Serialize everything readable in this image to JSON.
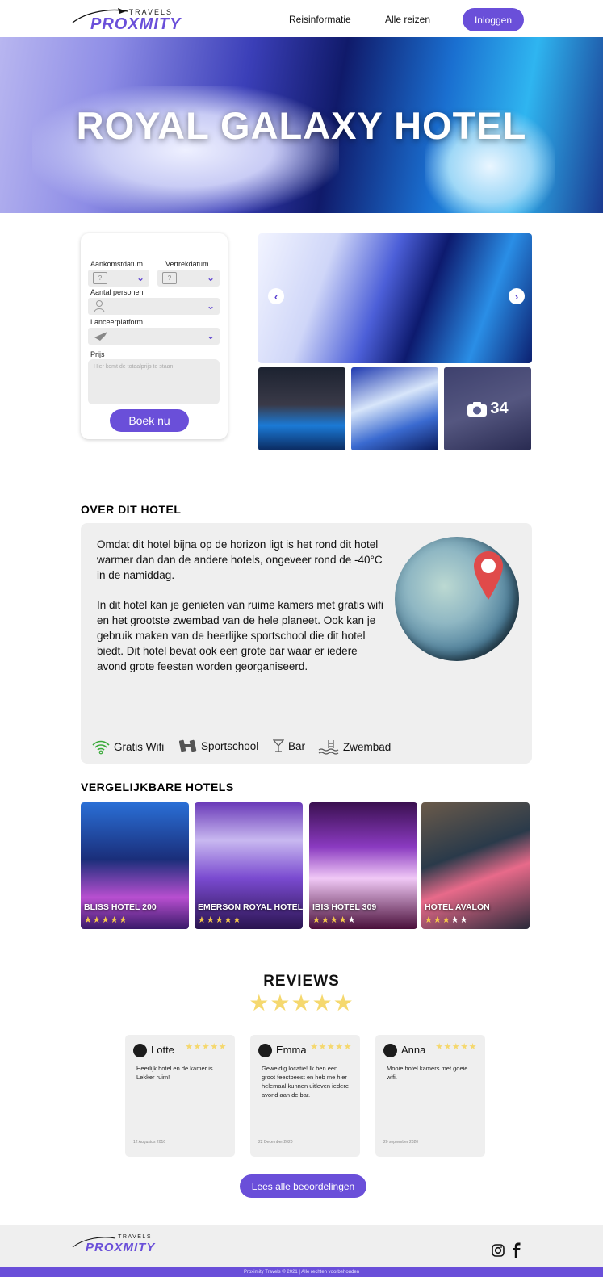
{
  "header": {
    "logo_travels": "TRAVELS",
    "logo_proximity": "PROXMITY",
    "nav": [
      "Reisinformatie",
      "Alle reizen"
    ],
    "login_label": "Inloggen"
  },
  "hero": {
    "title": "ROYAL GALAXY HOTEL"
  },
  "booking": {
    "arrival_label": "Aankomstdatum",
    "departure_label": "Vertrekdatum",
    "persons_label": "Aantal personen",
    "platform_label": "Lanceerplatform",
    "price_label": "Prijs",
    "price_placeholder": "Hier komt de totaalprijs te staan",
    "calendar_glyph": "?",
    "book_label": "Boek nu"
  },
  "gallery": {
    "photo_count": "34"
  },
  "about": {
    "title": "OVER DIT HOTEL",
    "paragraph_1": "Omdat dit hotel bijna op de horizon ligt is het rond dit hotel warmer dan dan de andere hotels, ongeveer rond de -40°C in de namiddag.",
    "paragraph_2": "In dit hotel kan je genieten van ruime kamers met gratis wifi en het grootste zwembad van de hele planeet. Ook kan je gebruik maken van de heerlijke sportschool die dit hotel biedt. Dit hotel bevat ook een grote bar waar er iedere avond grote feesten worden georganiseerd.",
    "amenities": [
      "Gratis Wifi",
      "Sportschool",
      "Bar",
      "Zwembad"
    ]
  },
  "similar": {
    "title": "VERGELIJKBARE HOTELS",
    "hotels": [
      {
        "name": "BLISS HOTEL 200",
        "rating": 5
      },
      {
        "name": "EMERSON ROYAL HOTEL",
        "rating": 5
      },
      {
        "name": "IBIS HOTEL 309",
        "rating": 4
      },
      {
        "name": "HOTEL AVALON",
        "rating": 3
      }
    ]
  },
  "reviews": {
    "title": "REVIEWS",
    "overall_rating": 5,
    "items": [
      {
        "name": "Lotte",
        "rating": 5,
        "text": "Heerlijk hotel en de kamer is Lekker ruim!",
        "date": "12 Augustus 2016"
      },
      {
        "name": "Emma",
        "rating": 5,
        "text": "Geweldig locatie! Ik ben een groot feestbeest en heb me hier helemaal kunnen uitleven iedere avond aan de bar.",
        "date": "22 December 2020"
      },
      {
        "name": "Anna",
        "rating": 5,
        "text": "Mooie hotel kamers met goeie wifi.",
        "date": "20 september 2020"
      }
    ],
    "all_label": "Lees alle beoordelingen"
  },
  "footer": {
    "logo_travels": "TRAVELS",
    "logo_proximity": "PROXMITY",
    "copyright": "Proximity Travels © 2021 | Alle rechten voorbehouden"
  },
  "colors": {
    "accent": "#6a4fd9",
    "star": "#f5d86e",
    "panel": "#efefef"
  }
}
